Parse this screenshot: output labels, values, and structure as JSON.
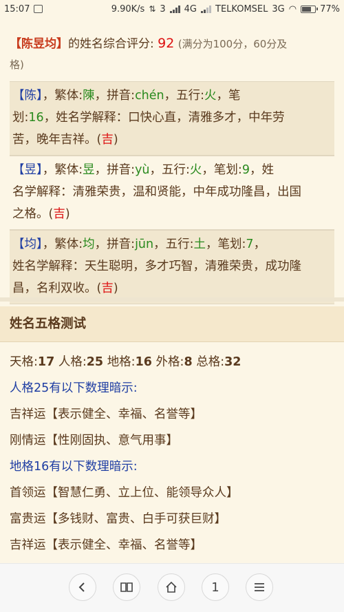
{
  "status": {
    "time": "15:07",
    "speed": "9.90K/s",
    "network": "4G",
    "sim1": "3",
    "carrier": "TELKOMSEL",
    "network2": "3G",
    "battery": "77%",
    "battery_level": 0.77
  },
  "score": {
    "name": "【陈昱均】",
    "text": "的姓名综合评分:",
    "value": "92",
    "note1": "(满分为100分，60分及",
    "note2": "格)"
  },
  "chars": [
    {
      "char": "【陈】",
      "trad_label": "，繁体:",
      "trad": "陳",
      "pinyin_label": "，拼音:",
      "pinyin": "chén",
      "wx_label": "，五行:",
      "wx": "火",
      "stroke_label": "，笔",
      "line2a": "划:",
      "stroke": "16",
      "line2b": "，姓名学解释：口快心直，清雅多才，中年劳",
      "line3": "苦，晚年吉祥。(",
      "luck": "吉",
      "close": ")"
    },
    {
      "char": "【昱】",
      "trad_label": "，繁体:",
      "trad": "昱",
      "pinyin_label": "，拼音:",
      "pinyin": "yù",
      "wx_label": "，五行:",
      "wx": "火",
      "stroke_label": "，笔划:",
      "stroke": "9",
      "line1b": "，姓",
      "line2": "名学解释：清雅荣贵，温和贤能，中年成功隆昌，出国",
      "line3": "之格。(",
      "luck": "吉",
      "close": ")"
    },
    {
      "char": "【均】",
      "trad_label": "，繁体:",
      "trad": "均",
      "pinyin_label": "，拼音:",
      "pinyin": "jūn",
      "wx_label": "，五行:",
      "wx": "土",
      "stroke_label": "，笔划:",
      "stroke": "7",
      "line1b": "，",
      "line2": "姓名学解释：天生聪明，多才巧智，清雅荣贵，成功隆",
      "line3": "昌，名利双收。(",
      "luck": "吉",
      "close": ")"
    }
  ],
  "wuge": {
    "title": "姓名五格测试",
    "tian_label": "天格:",
    "tian": "17",
    "ren_label": "人格:",
    "ren": "25",
    "di_label": "地格:",
    "di": "16",
    "wai_label": "外格:",
    "wai": "8",
    "zong_label": "总格:",
    "zong": "32",
    "ren_hint": "人格25有以下数理暗示:",
    "ren_items": [
      "吉祥运【表示健全、幸福、名誉等】",
      "刚情运【性刚固执、意气用事】"
    ],
    "di_hint": "地格16有以下数理暗示:",
    "di_items": [
      "首领运【智慧仁勇、立上位、能领导众人】",
      "富贵运【多钱财、富贵、白手可获巨财】",
      "吉祥运【表示健全、幸福、名誉等】"
    ]
  },
  "nav": {
    "back": "‹",
    "book": "book",
    "home": "home",
    "tabs": "1",
    "menu": "menu"
  }
}
